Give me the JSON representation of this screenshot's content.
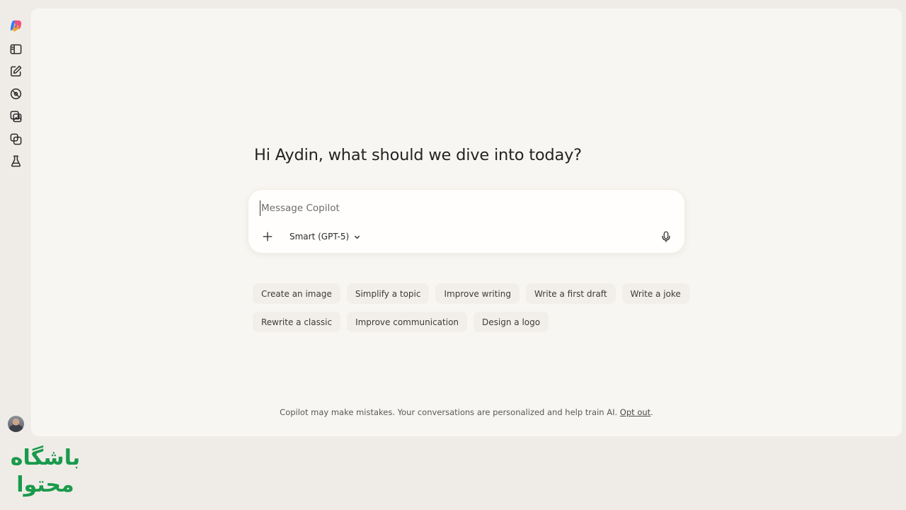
{
  "sidebar": {
    "items": [
      {
        "icon": "copilot-logo-icon"
      },
      {
        "icon": "sidebar-panel-icon"
      },
      {
        "icon": "new-chat-icon"
      },
      {
        "icon": "discover-icon"
      },
      {
        "icon": "images-icon"
      },
      {
        "icon": "pages-icon"
      },
      {
        "icon": "labs-icon"
      }
    ],
    "avatar": "user-avatar"
  },
  "main": {
    "greeting": "Hi Aydin, what should we dive into today?",
    "composer": {
      "placeholder": "Message Copilot",
      "value": "",
      "model_label": "Smart (GPT-5)"
    },
    "suggestions_row1": [
      "Create an image",
      "Simplify a topic",
      "Improve writing",
      "Write a first draft",
      "Write a joke"
    ],
    "suggestions_row2": [
      "Rewrite a classic",
      "Improve communication",
      "Design a logo"
    ],
    "disclaimer": "Copilot may make mistakes. Your conversations are personalized and help train AI.",
    "opt_out": "Opt out",
    "disclaimer_end": "."
  },
  "watermark": {
    "line1": "باشگاه",
    "line2": "محتوا"
  },
  "colors": {
    "page_bg": "#efece7",
    "canvas_bg": "#f8f6f2",
    "chip_bg": "#f2efea",
    "watermark_green": "#1a9a4c"
  }
}
